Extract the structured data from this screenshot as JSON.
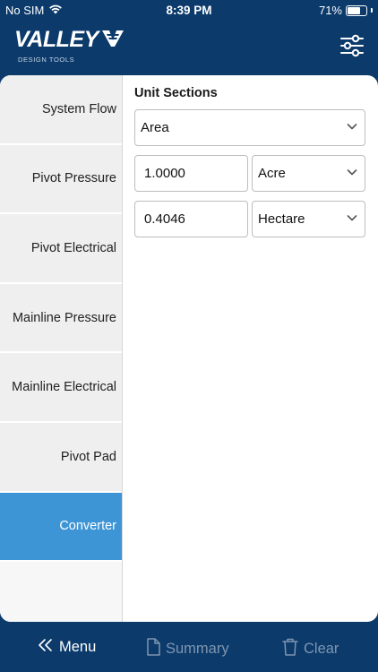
{
  "status": {
    "carrier": "No SIM",
    "time": "8:39 PM",
    "battery": "71%",
    "battery_level": 0.71
  },
  "header": {
    "logo_text": "VALLEY",
    "logo_sub": "DESIGN TOOLS"
  },
  "sidebar": {
    "items": [
      {
        "label": "System Flow"
      },
      {
        "label": "Pivot Pressure"
      },
      {
        "label": "Pivot Electrical"
      },
      {
        "label": "Mainline Pressure"
      },
      {
        "label": "Mainline Electrical"
      },
      {
        "label": "Pivot Pad"
      },
      {
        "label": "Converter"
      }
    ],
    "active": "Converter"
  },
  "converter": {
    "section_title": "Unit Sections",
    "section_value": "Area",
    "rows": [
      {
        "value": "1.0000",
        "unit": "Acre"
      },
      {
        "value": "0.4046",
        "unit": "Hectare"
      }
    ]
  },
  "bottom_bar": {
    "menu_label": "Menu",
    "summary_label": "Summary",
    "clear_label": "Clear"
  },
  "colors": {
    "brand_navy": "#0b3a6b",
    "active_blue": "#3e95d5",
    "disabled_text": "#7f95b0"
  }
}
